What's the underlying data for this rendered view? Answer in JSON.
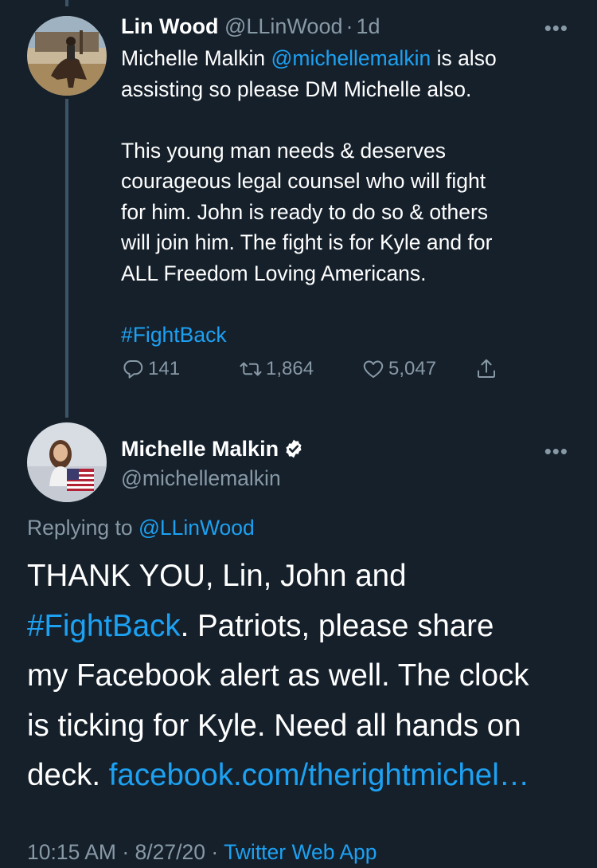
{
  "tweet1": {
    "name": "Lin Wood",
    "handle": "@LLinWood",
    "dot": "·",
    "time": "1d",
    "line1_prefix": "Michelle Malkin ",
    "line1_mention": "@michellemalkin",
    "line1_suffix": " is also",
    "line2": "assisting so please DM Michelle also.",
    "para2": [
      "This young man needs & deserves",
      "courageous legal counsel who will fight",
      "for him. John is ready to do so & others",
      "will join him. The fight is for Kyle and for",
      "ALL Freedom Loving Americans."
    ],
    "hashtag": "#FightBack",
    "replies": "141",
    "retweets": "1,864",
    "likes": "5,047",
    "more": "•••"
  },
  "tweet2": {
    "name": "Michelle Malkin",
    "handle": "@michellemalkin",
    "verified": true,
    "more": "•••",
    "replying_prefix": "Replying to ",
    "replying_handle": "@LLinWood",
    "line1": "THANK YOU, Lin, John and",
    "line2_hashtag": "#FightBack",
    "line2_rest": ". Patriots, please share",
    "line3": "my Facebook alert as well. The clock",
    "line4": "is ticking for Kyle. Need all hands on",
    "line5_prefix": "deck. ",
    "line5_link": "facebook.com/therightmichel…",
    "timestamp": "10:15 AM",
    "sep": "·",
    "date": "8/27/20",
    "source": "Twitter Web App"
  },
  "colors": {
    "background": "#15202b",
    "link": "#1da1f2",
    "muted": "#8899a6",
    "thread_line": "#3d5466"
  },
  "icons": [
    "reply-icon",
    "retweet-icon",
    "like-icon",
    "share-icon",
    "verified-badge-icon",
    "more-icon"
  ]
}
